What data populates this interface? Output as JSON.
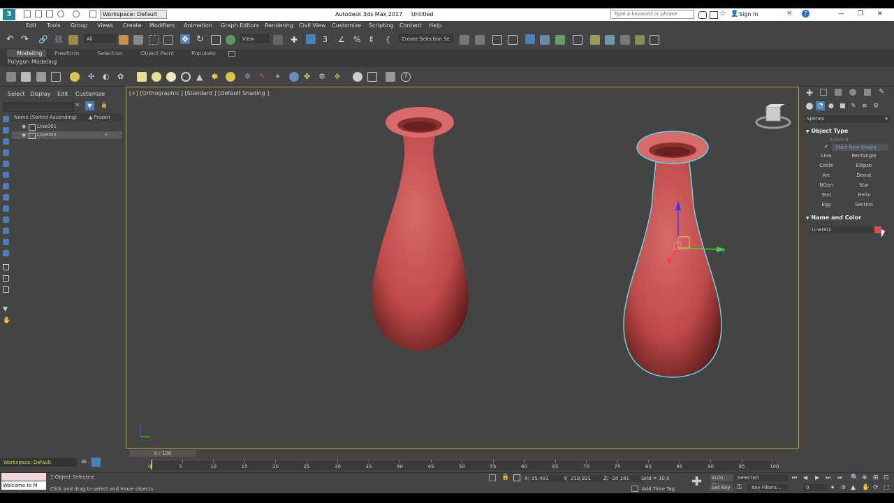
{
  "title_bar": {
    "workspace": "Workspace: Default",
    "app_title": "Autodesk 3ds Max 2017     Untitled",
    "search_placeholder": "Type a keyword or phrase",
    "sign_in": "Sign In"
  },
  "menu": [
    "Edit",
    "Tools",
    "Group",
    "Views",
    "Create",
    "Modifiers",
    "Animation",
    "Graph Editors",
    "Rendering",
    "Civil View",
    "Customize",
    "Scripting",
    "Content",
    "Help"
  ],
  "main_toolbar": {
    "filter_value": "All",
    "view_value": "View",
    "selection_set": "Create Selection Se"
  },
  "ribbon": {
    "tabs": [
      "Modeling",
      "Freeform",
      "Selection",
      "Object Paint",
      "Populate"
    ],
    "subtitle": "Polygon Modeling"
  },
  "scene_explorer": {
    "menu": [
      "Select",
      "Display",
      "Edit",
      "Customize"
    ],
    "col_name": "Name (Sorted Ascending)",
    "col_frozen": "▲ Frozen",
    "rows": [
      "Line001",
      "Line002"
    ]
  },
  "viewport": {
    "label": "[+] [Orthographic ] [Standard ] [Default Shading ]"
  },
  "command_panel": {
    "category": "Splines",
    "object_type_title": "Object Type",
    "autogrid": "AutoGrid",
    "start_new_shape": "Start New Shape",
    "buttons": [
      "Line",
      "Rectangle",
      "Circle",
      "Ellipse",
      "Arc",
      "Donut",
      "NGon",
      "Star",
      "Text",
      "Helix",
      "Egg",
      "Section"
    ],
    "name_color_title": "Name and Color",
    "object_name": "Line002",
    "object_color": "#d05050"
  },
  "timeline": {
    "frame": "0 / 100",
    "ticks": [
      "0",
      "5",
      "10",
      "15",
      "20",
      "25",
      "30",
      "35",
      "40",
      "45",
      "50",
      "55",
      "60",
      "65",
      "70",
      "75",
      "80",
      "85",
      "90",
      "95",
      "100"
    ]
  },
  "status": {
    "workspace": "Workspace: Default",
    "welcome": "Welcome to M",
    "selected": "1 Object Selected",
    "hint": "Click and drag to select and move objects",
    "x": "95,481",
    "y": "218,921",
    "z": "-20,181",
    "grid": "Grid = 10,0",
    "add_time_tag": "Add Time Tag",
    "auto_key": "Auto Key",
    "set_key": "Set Key",
    "key_mode": "Selected",
    "key_filters": "Key Filters...",
    "frame_field": "0"
  }
}
